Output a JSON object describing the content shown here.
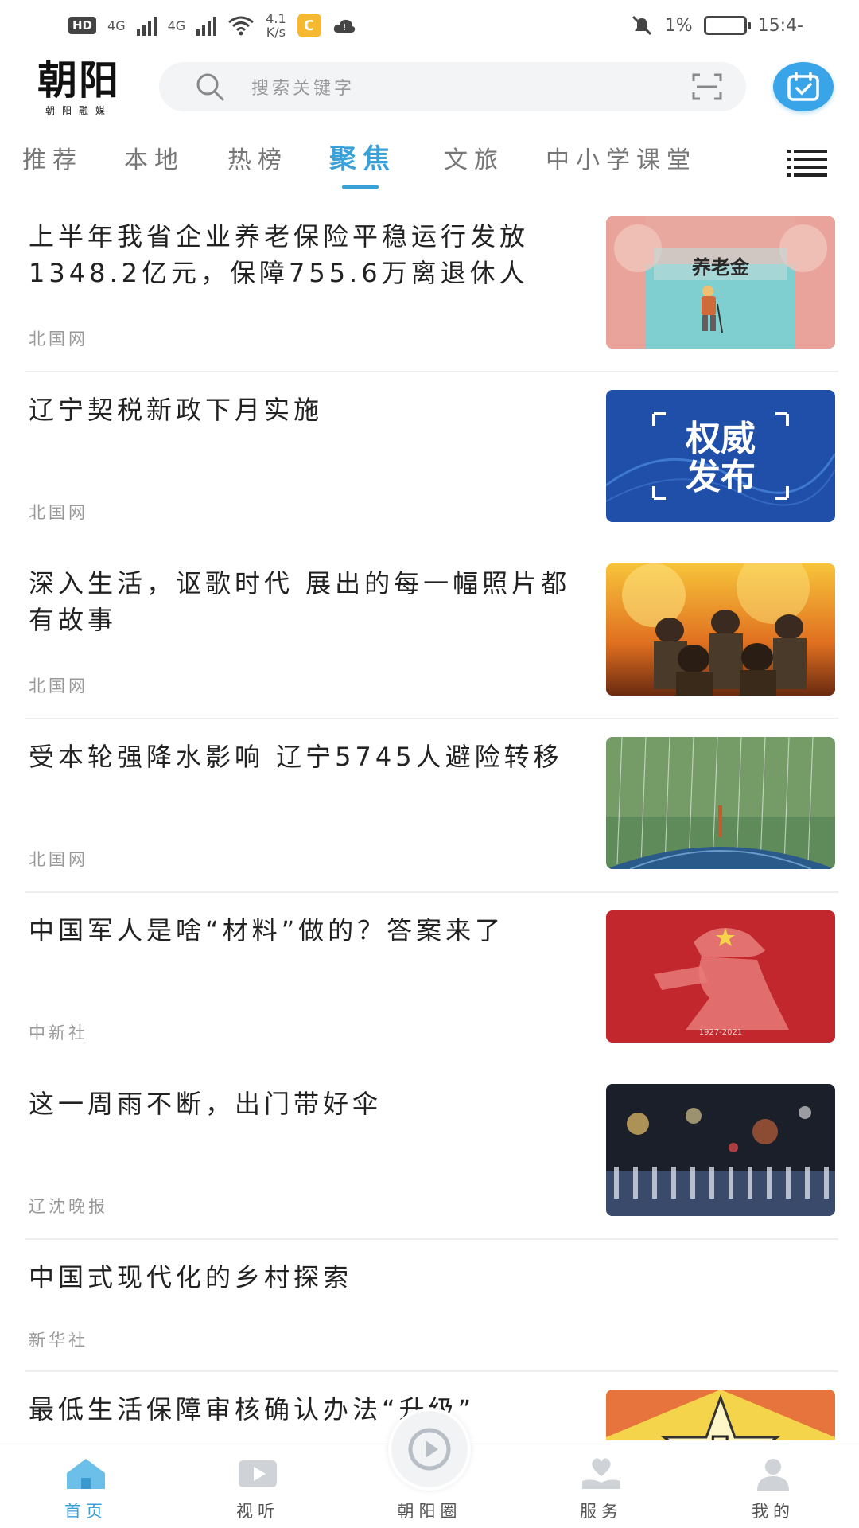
{
  "status_bar": {
    "hd_badge": "HD",
    "net_signal_1": "4G",
    "net_signal_2": "4G",
    "speed_value": "4.1",
    "speed_unit": "K/s",
    "battery": "1%",
    "time": "15:4-"
  },
  "header": {
    "logo_main": "朝阳",
    "logo_sub": "朝阳融媒",
    "search_placeholder": "搜索关键字"
  },
  "tabs": [
    {
      "label": "推荐"
    },
    {
      "label": "本地"
    },
    {
      "label": "热榜"
    },
    {
      "label": "聚焦",
      "active": true
    },
    {
      "label": "文旅"
    },
    {
      "label": "中小学课堂"
    }
  ],
  "feed": [
    {
      "title": "上半年我省企业养老保险平稳运行发放1348.2亿元，保障755.6万离退休人",
      "source": "北国网",
      "thumb_text": "养老金"
    },
    {
      "title": "辽宁契税新政下月实施",
      "source": "北国网",
      "thumb_text_1": "权威",
      "thumb_text_2": "发布"
    },
    {
      "title": "深入生活，讴歌时代 展出的每一幅照片都有故事",
      "source": "北国网"
    },
    {
      "title": "受本轮强降水影响 辽宁5745人避险转移",
      "source": "北国网"
    },
    {
      "title": "中国军人是啥“材料”做的？答案来了",
      "source": "中新社",
      "thumb_text": "1927-2021"
    },
    {
      "title": "这一周雨不断，出门带好伞",
      "source": "辽沈晚报"
    },
    {
      "title": "中国式现代化的乡村探索",
      "source": "新华社"
    },
    {
      "title": "最低生活保障审核确认办法“升级”",
      "thumb_text": "民"
    }
  ],
  "bottom_nav": [
    {
      "label": "首页",
      "active": true
    },
    {
      "label": "视听"
    },
    {
      "label": "朝阳圈"
    },
    {
      "label": "服务"
    },
    {
      "label": "我的"
    }
  ],
  "colors": {
    "accent": "#3aa0d8",
    "calendar_button": "#3aa4e8",
    "text_primary": "#222222",
    "text_source": "#999999"
  }
}
